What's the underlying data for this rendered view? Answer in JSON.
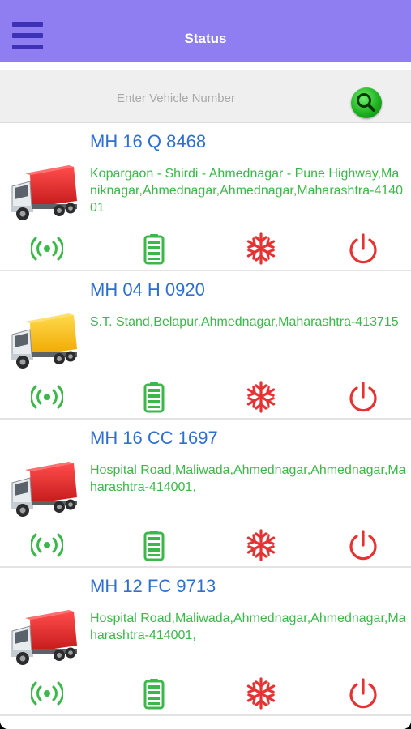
{
  "header": {
    "title": "Status",
    "menu_icon": "hamburger-menu-icon",
    "bar_color": "#8f7df2"
  },
  "search": {
    "placeholder": "Enter Vehicle Number",
    "value": "",
    "button_icon": "search-icon"
  },
  "vehicles": [
    {
      "number": "MH 16 Q 8468",
      "address": "Kopargaon - Shirdi - Ahmednagar - Pune Highway,Maniknagar,Ahmednagar,Ahmednagar,Maharashtra-414001",
      "truck_color": "red"
    },
    {
      "number": "MH 04 H 0920",
      "address": "S.T. Stand,Belapur,Ahmednagar,Maharashtra-413715",
      "truck_color": "yellow"
    },
    {
      "number": "MH 16 CC 1697",
      "address": "Hospital Road,Maliwada,Ahmednagar,Ahmednagar,Maharashtra-414001,",
      "truck_color": "red"
    },
    {
      "number": "MH 12 FC 9713",
      "address": "Hospital Road,Maliwada,Ahmednagar,Ahmednagar,Maharashtra-414001,",
      "truck_color": "red"
    }
  ],
  "status_icons": [
    "gps-signal-icon",
    "battery-icon",
    "ac-snowflake-icon",
    "power-icon"
  ],
  "colors": {
    "vehicle_number": "#2f6fcf",
    "address": "#3cb84a",
    "status_ok": "#3cb84a",
    "status_alert": "#e53232"
  }
}
